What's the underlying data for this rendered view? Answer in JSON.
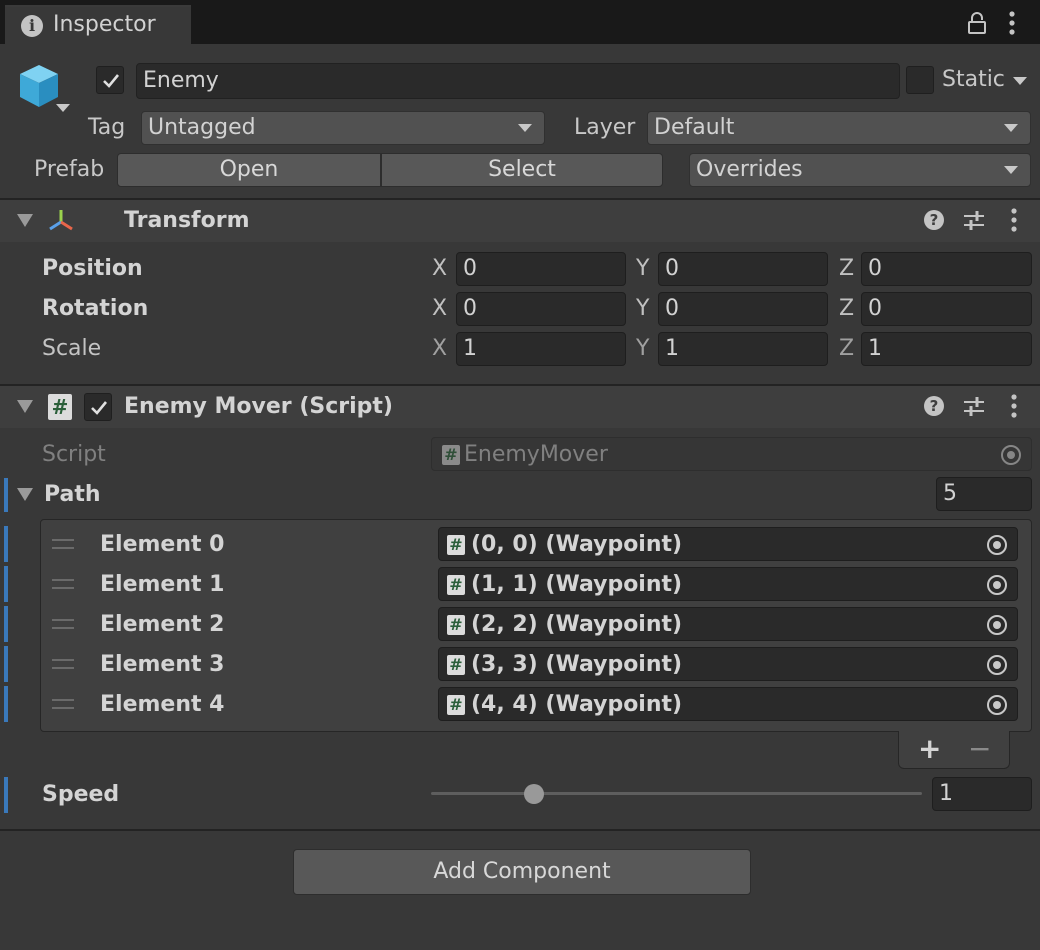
{
  "window": {
    "tab_title": "Inspector",
    "tab_icon": "info-icon",
    "lock_icon": "lock-icon",
    "menu_icon": "kebab-menu-icon"
  },
  "gameobject": {
    "icon": "cube-icon",
    "active": true,
    "name": "Enemy",
    "static_label": "Static",
    "static_checked": false,
    "tag_label": "Tag",
    "tag_value": "Untagged",
    "layer_label": "Layer",
    "layer_value": "Default",
    "prefab_label": "Prefab",
    "prefab_open": "Open",
    "prefab_select": "Select",
    "prefab_overrides": "Overrides"
  },
  "transform": {
    "title": "Transform",
    "icon": "transform-axes-icon",
    "rows": [
      {
        "label": "Position",
        "x": "0",
        "y": "0",
        "z": "0"
      },
      {
        "label": "Rotation",
        "x": "0",
        "y": "0",
        "z": "0"
      },
      {
        "label": "Scale",
        "x": "1",
        "y": "1",
        "z": "1"
      }
    ],
    "axis_x": "X",
    "axis_y": "Y",
    "axis_z": "Z"
  },
  "script_component": {
    "title": "Enemy Mover (Script)",
    "enabled": true,
    "script_label": "Script",
    "script_value": "EnemyMover",
    "path_label": "Path",
    "path_size": "5",
    "elements": [
      {
        "label": "Element 0",
        "value": "(0, 0) (Waypoint)"
      },
      {
        "label": "Element 1",
        "value": "(1, 1) (Waypoint)"
      },
      {
        "label": "Element 2",
        "value": "(2, 2) (Waypoint)"
      },
      {
        "label": "Element 3",
        "value": "(3, 3) (Waypoint)"
      },
      {
        "label": "Element 4",
        "value": "(4, 4) (Waypoint)"
      }
    ],
    "add_symbol": "+",
    "remove_symbol": "−",
    "speed_label": "Speed",
    "speed_value": "1",
    "speed_slider_fraction": 0.21
  },
  "add_component_label": "Add Component",
  "colors": {
    "background": "#383838",
    "modified_bar": "#3a79bb",
    "checkmark": "#e0e0e0"
  }
}
